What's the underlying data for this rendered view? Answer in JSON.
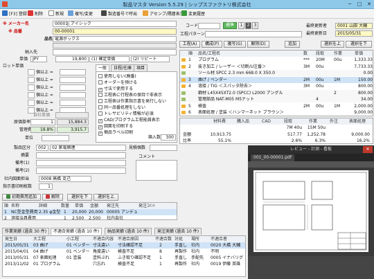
{
  "window": {
    "title": "製品マスタ Version 5.5.29 | シップスファクトリ株式会社",
    "min": "─",
    "max": "□",
    "close": "✕"
  },
  "toolbar": {
    "register": "[F3] 登録",
    "delete": "削除",
    "new": "新規",
    "copy_change": "複写/変更",
    "make_drawing": "製造番号で呼出",
    "upload": "アセンブ/隅層表示",
    "history": "変更履歴"
  },
  "product": {
    "maker_label": "※ メーカー名",
    "maker_code": "00001",
    "maker_name": "アイシック",
    "number_label": "※ 品番",
    "number_value": "00-00001",
    "name_label": "品名",
    "name_value": "電源ボックス",
    "delivery_label": "納入先",
    "price_label": "単価",
    "currency": "JPY",
    "price": "19,800",
    "price_type": "(1) 確定単価",
    "price_type2": "(2) リピート",
    "lot_label": "ロット単価",
    "lot_rows": [
      "個以上 =",
      "個以上 =",
      "個以上 =",
      "個以上 =",
      "個以上 =",
      "個以上 ="
    ],
    "self_price_label": "自社単価",
    "cost_rate_label": "原価掛率",
    "cost_rate": "1",
    "cost_rate_value": "15,884.3",
    "mgmt_cost_label": "管理費",
    "mgmt_cost_pct": "19.8%",
    "mgmt_cost_value": "3,915.7",
    "unit_label": "単位",
    "division_label": "製品区分",
    "division_code": "002",
    "division_name": "02 家電関連",
    "notes_label": "摘要",
    "remark1_label": "備考(1)",
    "remark2_label": "備考(2)",
    "staff_label": "社内図面担当",
    "staff_value": "0008 高橋 克己",
    "shipping_label": "指示書印刷枚数",
    "shipping_value": "1",
    "estimate_label": "見積個数",
    "comment_label": "コメント"
  },
  "options": {
    "tabs": [
      "一般",
      "日程/在庫",
      "項目"
    ],
    "checks": [
      {
        "label": "使用しない(廃番)",
        "checked": false
      },
      {
        "label": "オーダーを预ける",
        "checked": false
      },
      {
        "label": "寸法で使用する",
        "checked": true
      },
      {
        "label": "工程表に行程表の保持で非表示",
        "checked": false
      },
      {
        "label": "工程表は作業指示書を発行しない",
        "checked": false
      },
      {
        "label": "同一品番処理をしない",
        "checked": false
      },
      {
        "label": "トレサビリティ情報が必須",
        "checked": false
      },
      {
        "label": "CAD/プログラム工程能員表示",
        "checked": true
      },
      {
        "label": "図面を印刷する",
        "checked": true
      },
      {
        "label": "梱品ラベル印刷",
        "checked": true
      }
    ],
    "qty_label": "箱入数",
    "qty_value": "300"
  },
  "right_header": {
    "code_label": "コード",
    "std_button": "標準",
    "pages": [
      "1",
      "2",
      "3"
    ],
    "process_label": "工程パターン",
    "first_reg_label": "最終更新者",
    "first_reg_value": "0001 山田 大輔",
    "last_update_label": "最終更新日",
    "last_update_value": "2015/05/31"
  },
  "process_toolbar": {
    "process": "工程(A)",
    "config": "構成(P)",
    "copy": "複写(G)",
    "unregister": "解除(D)",
    "add": "追加",
    "select_up": "選択を上",
    "select_down": "選択を下"
  },
  "process_table": {
    "headers": [
      "順",
      "品名/工程名",
      "数",
      "段取",
      "作業",
      "単価"
    ],
    "rows": [
      {
        "no": "1",
        "name": "プログラム",
        "qty": "***",
        "setup": "20M",
        "work": "00u",
        "price": "1,333.33"
      },
      {
        "no": "2",
        "name": "抜き加工 / レーザー ＜切断/U注番＞",
        "qty": "3M",
        "setup": "00u",
        "work": "",
        "price": "7,733.33"
      },
      {
        "no": "",
        "name": "ソール材 SPCC 2.3 mm 668.0 X 350.0",
        "qty": "",
        "setup": "",
        "work": "",
        "price": "0.00"
      },
      {
        "no": "3",
        "name": "曲げ / ベンダー",
        "qty": "2M",
        "setup": "00u",
        "work": "1M",
        "price": "150.00"
      },
      {
        "no": "4",
        "name": "溶接 / TIG ＜スパッタ除去＞",
        "qty": "3M",
        "setup": "00u",
        "work": "",
        "price": "800.00"
      },
      {
        "no": "",
        "name": "鋼材 L45X45XT2.0 (SPCC) L2000 アングル",
        "qty": "",
        "setup": "",
        "work": "2",
        "price": "800.00"
      },
      {
        "no": "",
        "name": "管理部品 NAT-M05 M5ナット",
        "qty": "",
        "setup": "4",
        "work": "",
        "price": "34.00"
      },
      {
        "no": "5",
        "name": "検査",
        "qty": "2M",
        "setup": "00u",
        "work": "1M",
        "price": "2,000.00"
      },
      {
        "no": "6",
        "name": "表面処理 / 塗装 ＜ハンマーネット ブラウン＞",
        "qty": "",
        "setup": "",
        "work": "",
        "price": "9,000.00"
      }
    ]
  },
  "cost_table": {
    "headers": [
      "",
      "材料費",
      "購入品",
      "CAD",
      "段取",
      "作業",
      "外注",
      "表面処理"
    ],
    "rows": [
      {
        "label": "",
        "vals": [
          "",
          "",
          "",
          "7M 40u",
          "15M 50u",
          "",
          ""
        ]
      },
      {
        "label": "金額",
        "vals": [
          "10,913.75",
          "",
          "",
          "517.77",
          "1,252.78",
          "",
          "9,000.00"
        ]
      },
      {
        "label": "比率",
        "vals": [
          "55.1%",
          "",
          "",
          "2.6%",
          "6.3%",
          "",
          "16.2%"
        ]
      }
    ],
    "total_label": "合計"
  },
  "parts_toolbar": {
    "add": "初期費用追加",
    "remove": "解除",
    "select_up": "選択を下",
    "select_down": "選択を上"
  },
  "parts_table": {
    "headers": [
      "順",
      "名称",
      "詳細",
      "数量",
      "単価",
      "金額",
      "発注先",
      "発注ｺﾒﾝﾄ"
    ],
    "rows": [
      {
        "no": "1",
        "name": "NC型金型費用",
        "detail": "2.35 φ金型",
        "qty": "1",
        "price": "20,000",
        "amount": "20,000",
        "vendor": "00005 アンデュ"
      },
      {
        "no": "2",
        "name": "溶接治具費用",
        "detail": "",
        "qty": "1",
        "price": "2,500",
        "amount": "2,500",
        "vendor": "社内自社"
      }
    ]
  },
  "bottom_tabs": [
    "作業実績 (過去 30 件)",
    "不適合実績 (過去 10 件)",
    "納品実績 (過去 10 件)",
    "発注実績 (過去 10 件)"
  ],
  "ncr_table": {
    "headers": [
      "発生日",
      "大工程",
      "小工程",
      "不適合内容",
      "不適合原因",
      "不適合数",
      "対処",
      "場所",
      "不適合者"
    ],
    "rows": [
      {
        "date": "2015/05/31",
        "p1": "03 曲げ",
        "p2": "01 ベンダー",
        "content": "寸法違い",
        "cause": "寸法確認不足",
        "qty": "2",
        "act": "手直し",
        "place": "社内",
        "person": "0020 大橋 大輔"
      },
      {
        "date": "2015/04/01",
        "p1": "04 曲げ",
        "p2": "01 ベンダー",
        "content": "角度違い",
        "cause": "検査不足",
        "qty": "8",
        "act": "再製作",
        "place": "社内",
        "person": "不明"
      },
      {
        "date": "2013/05/31",
        "p1": "07 表面処理",
        "p2": "01 塗装",
        "content": "塗料ぶれ",
        "cause": "ふき取り確認不足",
        "qty": "1",
        "act": "手直し",
        "place": "手配先",
        "person": "0005 イナバリグ"
      },
      {
        "date": "2013/11/02",
        "p1": "01 プログラム",
        "p2": "",
        "content": "穴忘れ",
        "cause": "検査不足",
        "qty": "1",
        "act": "再製作",
        "place": "社内",
        "person": "0019 伊藤 英雄"
      }
    ]
  },
  "preview": {
    "title": "レビュー - 計測 - 看板",
    "file": "001_00-00001.pdf",
    "close": "✕"
  }
}
